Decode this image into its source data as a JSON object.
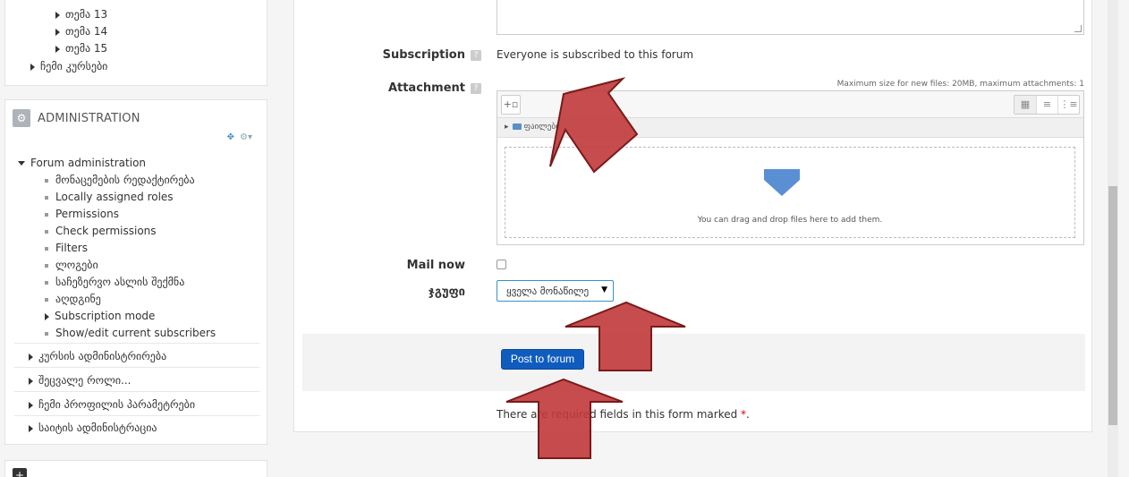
{
  "sidebar": {
    "nav_items": [
      "თემა 13",
      "თემა 14",
      "თემა 15",
      "ჩემი კურსები"
    ],
    "admin": {
      "title": "ADMINISTRATION",
      "forum_admin_label": "Forum administration",
      "forum_admin_items": [
        "მონაცემების რედაქტირება",
        "Locally assigned roles",
        "Permissions",
        "Check permissions",
        "Filters",
        "ლოგები",
        "საჩეზერვო ასლის შექმნა",
        "აღდგინე",
        "Subscription mode",
        "Show/edit current subscribers"
      ],
      "sections": [
        "კურსის ადმინისტრირება",
        "შეცვალე როლი...",
        "ჩემი პროფილის პარამეტრები",
        "საიტის ადმინისტრაცია"
      ]
    }
  },
  "form": {
    "subscription": {
      "label": "Subscription",
      "value": "Everyone is subscribed to this forum"
    },
    "attachment": {
      "label": "Attachment",
      "max_size": "Maximum size for new files: 20MB, maximum attachments: 1",
      "path_folder": "ფაილები",
      "drop_text": "You can drag and drop files here to add them."
    },
    "mail_now": {
      "label": "Mail now",
      "checked": false
    },
    "group": {
      "label": "ჯგუფი",
      "selected": "ყველა მონაწილე"
    },
    "submit_label": "Post to forum",
    "required_note_prefix": "There are required fields in this form marked",
    "required_marker": "*",
    "required_note_suffix": "."
  },
  "colors": {
    "primary_button": "#0f5cbe",
    "annotation_arrow": "#c0393b",
    "accent_blue": "#3a8fcb"
  },
  "icons": {
    "admin_block": "gear-icon",
    "add_file": "add-file-icon",
    "folder": "folder-icon",
    "drop": "down-arrow-icon",
    "views": [
      "grid-view-icon",
      "list-view-icon",
      "tree-view-icon"
    ]
  }
}
